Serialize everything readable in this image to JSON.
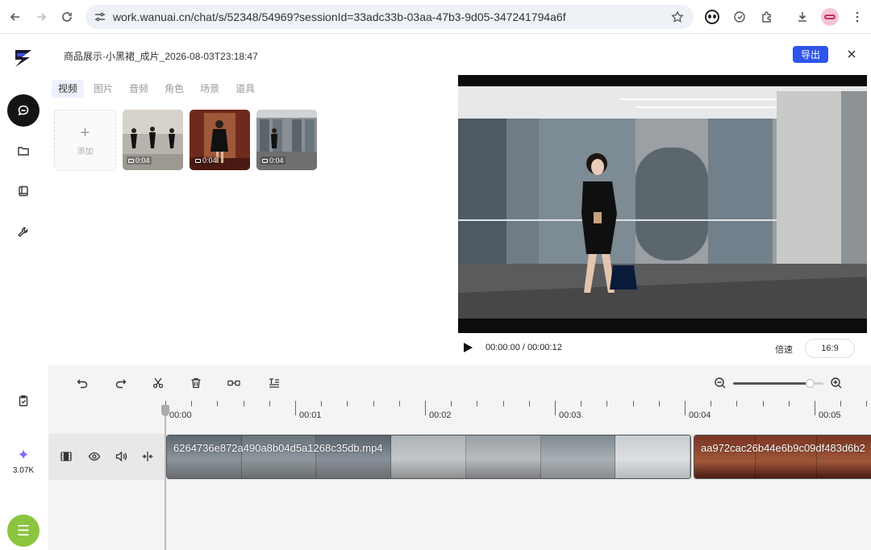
{
  "browser": {
    "url": "work.wanuai.cn/chat/s/52348/54969?sessionId=33adc33b-03aa-47b3-9d05-347241794a6f"
  },
  "header": {
    "doc_title": "商品展示·小黑裙_成片_2026-08-03T23:18:47",
    "export_label": "导出"
  },
  "asset_tabs": [
    {
      "label": "视频",
      "active": true
    },
    {
      "label": "图片",
      "active": false
    },
    {
      "label": "音频",
      "active": false
    },
    {
      "label": "角色",
      "active": false
    },
    {
      "label": "场景",
      "active": false
    },
    {
      "label": "道具",
      "active": false
    }
  ],
  "asset_grid": {
    "add_label": "添加",
    "items": [
      {
        "duration": "0:04"
      },
      {
        "duration": "0:04"
      },
      {
        "duration": "0:04"
      }
    ]
  },
  "player": {
    "time": "00:00:00 / 00:00:12",
    "speed_label": "倍速",
    "ratio": "16:9"
  },
  "timeline": {
    "zoom_level": 0.85,
    "ruler_labels": [
      "00:00",
      "00:01",
      "00:02",
      "00:03",
      "00:04",
      "00:05"
    ],
    "clips": [
      {
        "name": "6264736e872a490a8b04d5a1268c35db.mp4"
      },
      {
        "name": "aa972cac26b44e6b9c09df483d6b2"
      }
    ]
  },
  "sidebar": {
    "credits": "3.07K"
  },
  "colors": {
    "accent": "#2f54eb",
    "fab": "#8bc53f",
    "spark": "#7b6cff"
  }
}
